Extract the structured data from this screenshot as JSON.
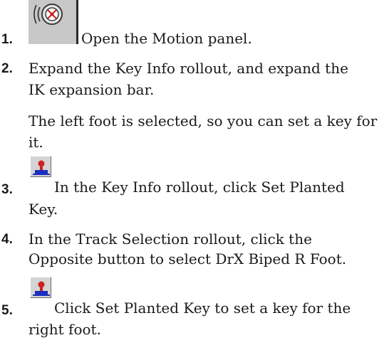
{
  "steps": [
    {
      "number": "1.",
      "icon": "motion-panel-icon",
      "lines": [
        "Open the Motion panel."
      ]
    },
    {
      "number": "2.",
      "lines": [
        "Expand the Key Info rollout, and expand the",
        "IK expansion bar."
      ],
      "note_lines": [
        "The left foot is selected, so you can set a key for",
        "it."
      ]
    },
    {
      "number": "3.",
      "icon": "set-planted-key-icon",
      "lines": [
        "In the Key Info rollout, click Set Planted",
        "Key."
      ]
    },
    {
      "number": "4.",
      "lines": [
        "In the Track Selection rollout, click the",
        "Opposite button to select DrX Biped R Foot."
      ]
    },
    {
      "number": "5.",
      "icon": "set-planted-key-icon",
      "lines": [
        "Click Set Planted Key to set a key for the",
        "right foot."
      ]
    }
  ],
  "colors": {
    "text": "#1a1a1a",
    "icon_face": "#d4d4d4",
    "key_red": "#cc2222",
    "key_blue": "#1a2fbf"
  }
}
